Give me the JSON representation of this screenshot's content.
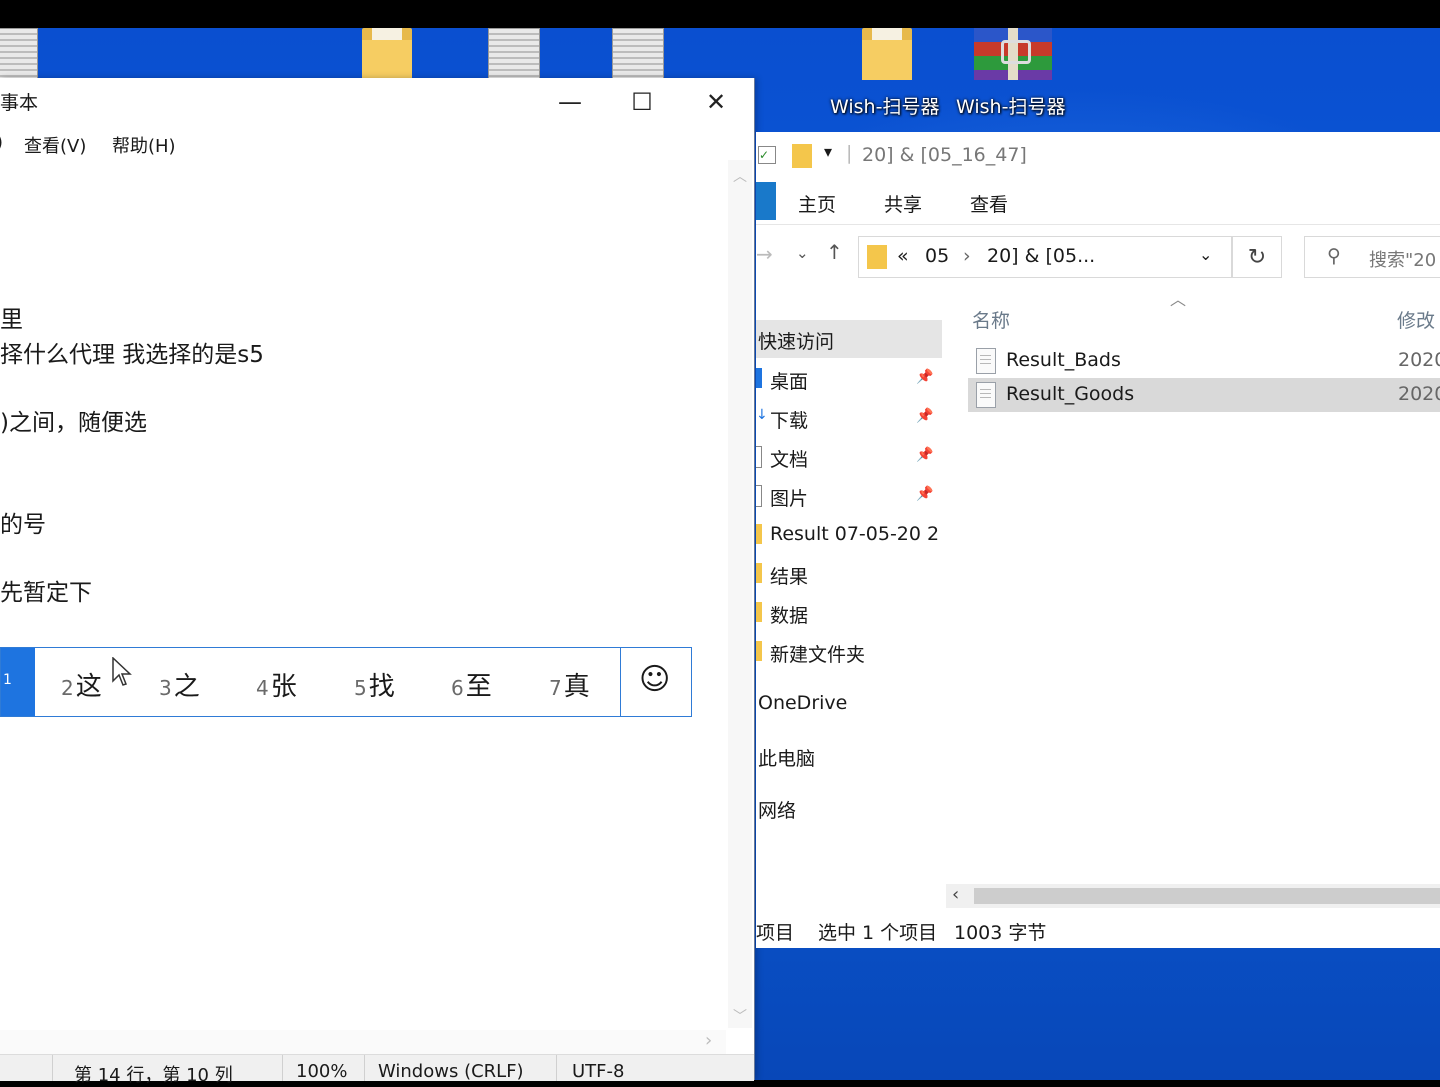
{
  "desktop": {
    "icons": [
      {
        "label": "Wish-扫号器",
        "icon": "folder-icon"
      },
      {
        "label": "Wish-扫号器",
        "icon": "winrar-archive-icon"
      }
    ]
  },
  "notepad": {
    "title": "事本",
    "menu": [
      "查看(V)",
      "帮助(H)"
    ],
    "lines": [
      "里",
      "择什么代理  我选择的是s5",
      ")之间，随便选",
      "的号",
      "先暂定下"
    ],
    "status": {
      "position": "第 14 行，第 10 列",
      "zoom": "100%",
      "line_ending": "Windows (CRLF)",
      "encoding": "UTF-8"
    }
  },
  "ime": {
    "selected_number": "1",
    "candidates": [
      {
        "num": "2",
        "char": "这"
      },
      {
        "num": "3",
        "char": "之"
      },
      {
        "num": "4",
        "char": "张"
      },
      {
        "num": "5",
        "char": "找"
      },
      {
        "num": "6",
        "char": "至"
      },
      {
        "num": "7",
        "char": "真"
      }
    ],
    "emoji": "☺"
  },
  "explorer": {
    "title": "20] & [05_16_47]",
    "ribbon_tabs": [
      "主页",
      "共享",
      "查看"
    ],
    "address": {
      "chevron": "«",
      "crumb1": "05",
      "separator": "›",
      "crumb2": "20] & [05..."
    },
    "search_placeholder": "搜索\"20",
    "nav": {
      "quick_access": "快速访问",
      "pinned": [
        "桌面",
        "下载",
        "文档",
        "图片"
      ],
      "folders": [
        "Result 07-05-20 2",
        "结果",
        "数据",
        "新建文件夹"
      ],
      "onedrive": "OneDrive",
      "this_pc": "此电脑",
      "network": "网络"
    },
    "columns": {
      "name": "名称",
      "modified": "修改"
    },
    "files": [
      {
        "name": "Result_Bads",
        "date": "2020",
        "selected": false
      },
      {
        "name": "Result_Goods",
        "date": "2020",
        "selected": true
      }
    ],
    "status": {
      "items": "项目",
      "selected": "选中 1 个项目",
      "size": "1003 字节"
    }
  }
}
